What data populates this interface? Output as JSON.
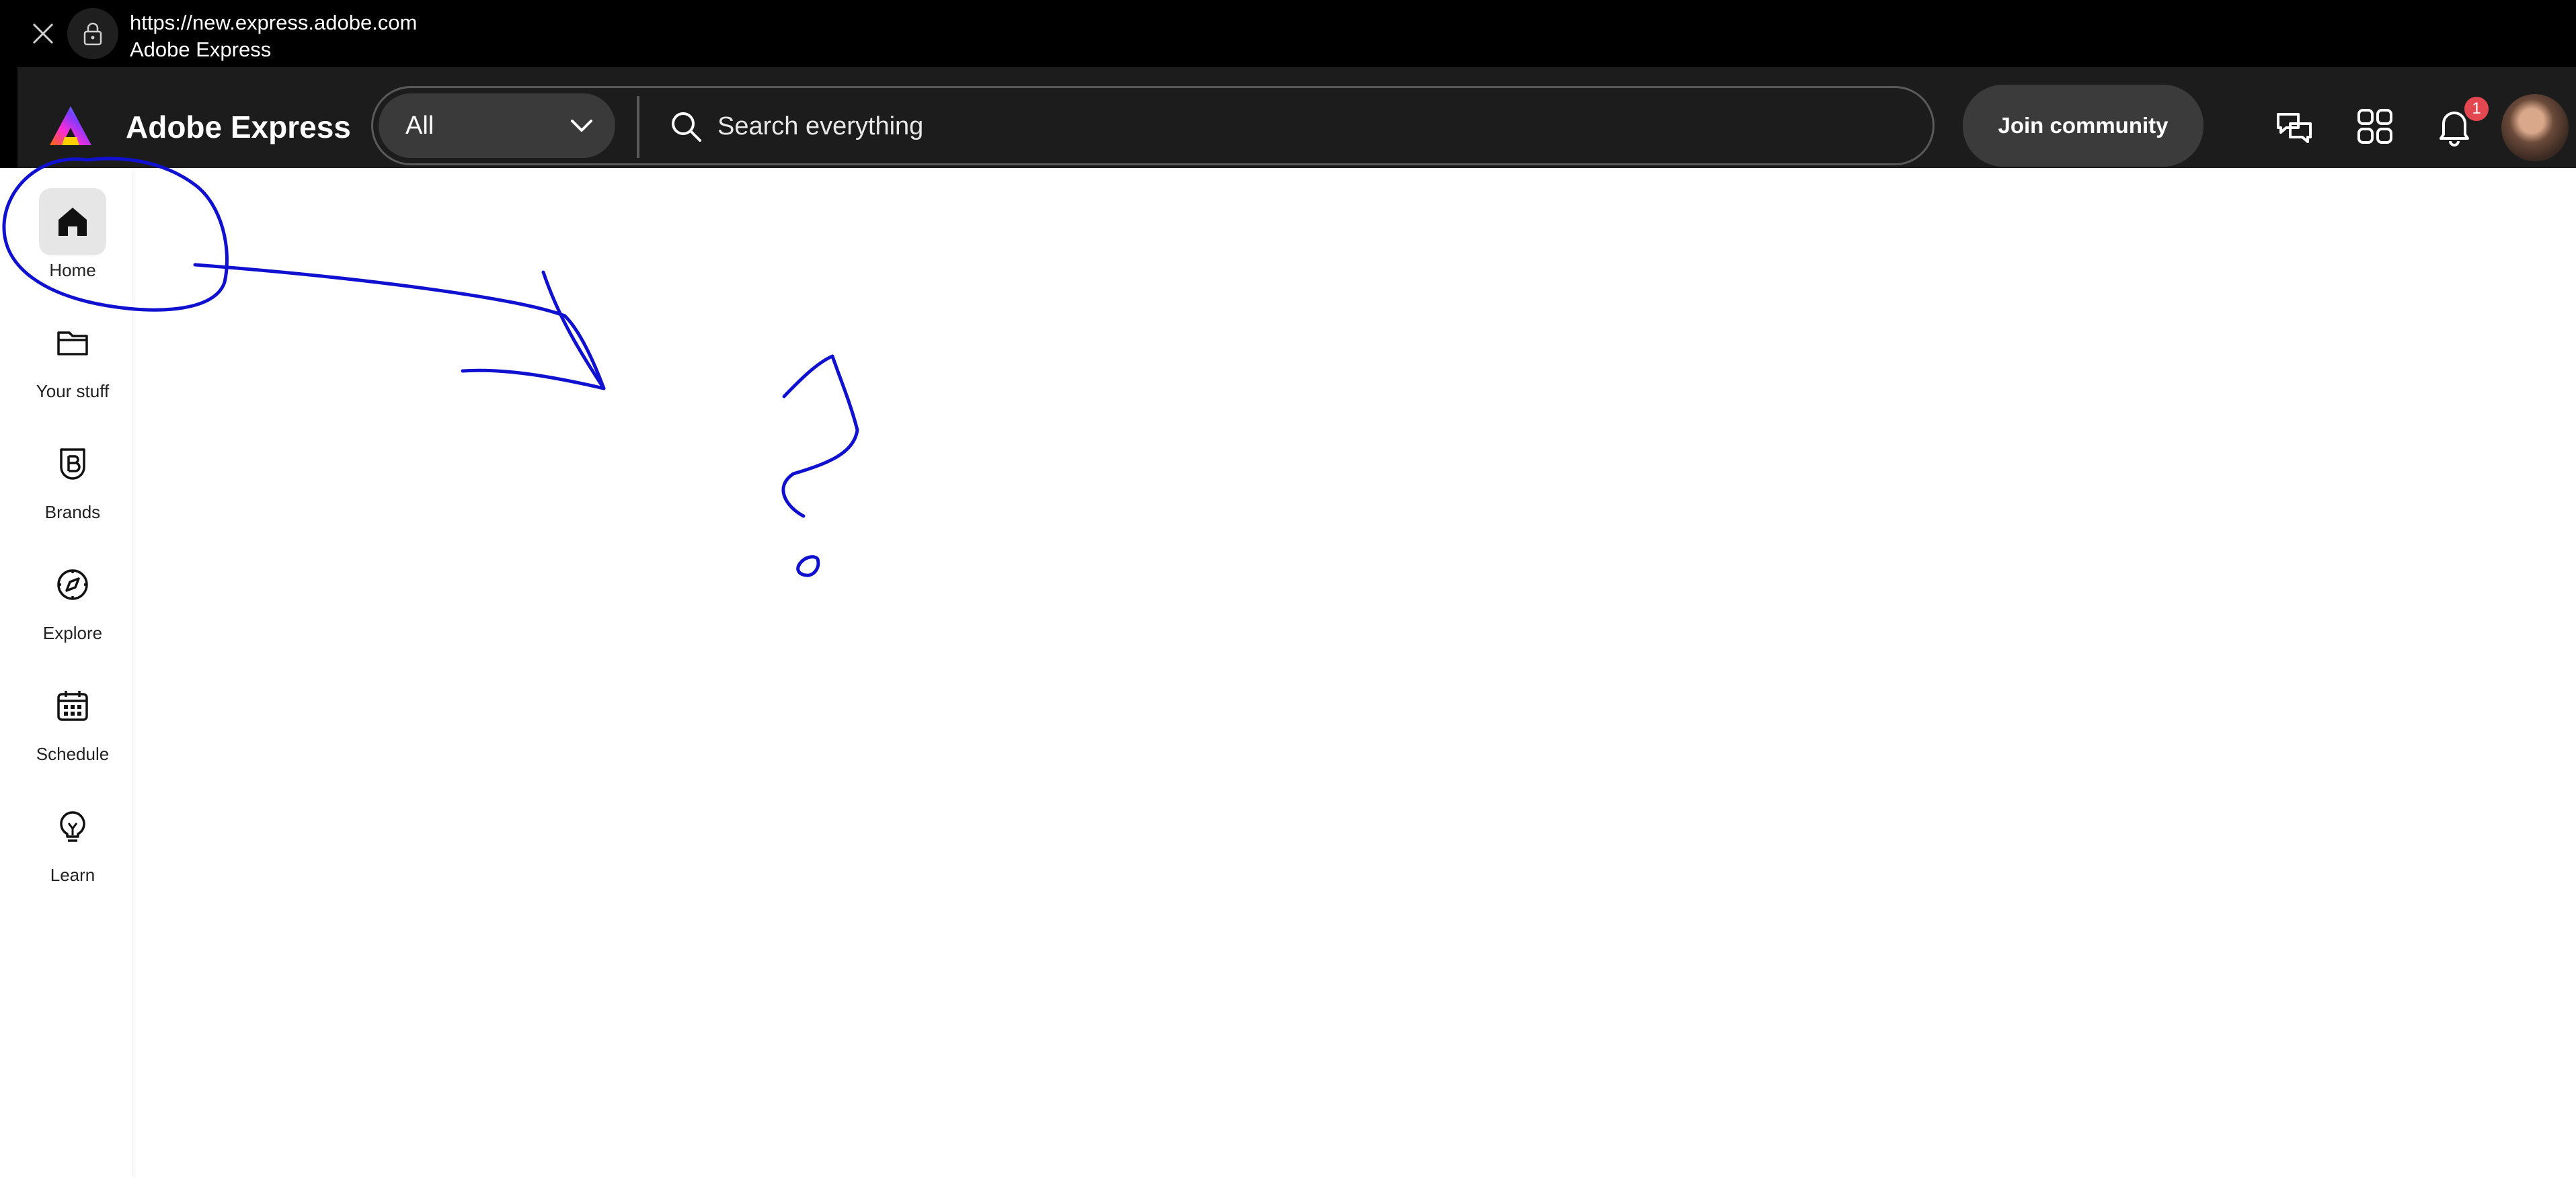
{
  "browser": {
    "url": "https://new.express.adobe.com",
    "page_title": "Adobe Express"
  },
  "header": {
    "brand": "Adobe Express",
    "search": {
      "scope": "All",
      "placeholder": "Search everything"
    },
    "join_label": "Join community",
    "notification_count": "1"
  },
  "sidebar": {
    "items": [
      {
        "label": "Home",
        "icon": "home-icon",
        "active": true
      },
      {
        "label": "Your stuff",
        "icon": "folder-icon"
      },
      {
        "label": "Brands",
        "icon": "brand-shield-icon"
      },
      {
        "label": "Explore",
        "icon": "compass-icon"
      },
      {
        "label": "Schedule",
        "icon": "calendar-icon"
      },
      {
        "label": "Learn",
        "icon": "lightbulb-icon"
      }
    ]
  },
  "colors": {
    "header_bg": "#1c1c1c",
    "annotation_ink": "#1010d0",
    "badge": "#e34850"
  }
}
